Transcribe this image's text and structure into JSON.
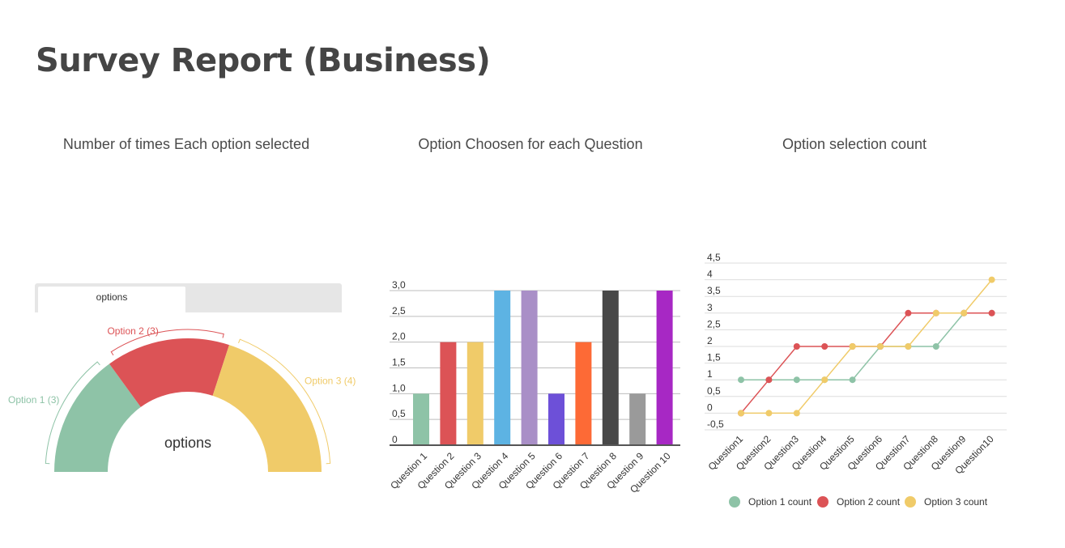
{
  "page": {
    "title": "Survey Report  (Business)"
  },
  "panels": {
    "gauge_title": "Number of times Each option selected",
    "bar_title": "Option Choosen for each Question",
    "line_title": "Option selection count"
  },
  "gauge": {
    "tab_label": "options",
    "center_label": "options"
  },
  "chart_data": [
    {
      "type": "pie",
      "variant": "half-donut",
      "categories": [
        "Option 1",
        "Option 2",
        "Option 3"
      ],
      "values": [
        3,
        3,
        4
      ],
      "labels": [
        "Option 1 (3)",
        "Option 2 (3)",
        "Option 3 (4)"
      ],
      "colors": [
        "#8ec3a7",
        "#dc5356",
        "#f0cb69"
      ],
      "center_label": "options"
    },
    {
      "type": "bar",
      "title": "Option Choosen for each Question",
      "categories": [
        "Question 1",
        "Question 2",
        "Question 3",
        "Question 4",
        "Question 5",
        "Question 6",
        "Question 7",
        "Question 8",
        "Question 9",
        "Question 10"
      ],
      "values": [
        1,
        2,
        2,
        3,
        3,
        1,
        2,
        3,
        1,
        3
      ],
      "colors": [
        "#8ec3a7",
        "#dc5356",
        "#f0cb69",
        "#5db3e3",
        "#a98fc7",
        "#6d50d8",
        "#fd6a36",
        "#484848",
        "#9a9a9a",
        "#a728c4"
      ],
      "ylim": [
        0,
        3
      ],
      "yticks": [
        "0",
        "0,5",
        "1,0",
        "1,5",
        "2,0",
        "2,5",
        "3,0"
      ],
      "grid": true
    },
    {
      "type": "line",
      "title": "Option selection count",
      "categories": [
        "Question1",
        "Question2",
        "Question3",
        "Question4",
        "Question5",
        "Question6",
        "Question7",
        "Question8",
        "Question9",
        "Question10"
      ],
      "series": [
        {
          "name": "Option 1 count",
          "color": "#8ec3a7",
          "values": [
            1,
            1,
            1,
            1,
            1,
            2,
            2,
            2,
            3,
            3
          ]
        },
        {
          "name": "Option 2 count",
          "color": "#dc5356",
          "values": [
            0,
            1,
            2,
            2,
            2,
            2,
            3,
            3,
            3,
            3
          ]
        },
        {
          "name": "Option 3 count",
          "color": "#f0cb69",
          "values": [
            0,
            0,
            0,
            1,
            2,
            2,
            2,
            3,
            3,
            4
          ]
        }
      ],
      "ylim": [
        -0.5,
        4.5
      ],
      "yticks": [
        "-0,5",
        "0",
        "0,5",
        "1",
        "1,5",
        "2",
        "2,5",
        "3",
        "3,5",
        "4",
        "4,5"
      ],
      "grid": true,
      "legend": "bottom"
    }
  ]
}
